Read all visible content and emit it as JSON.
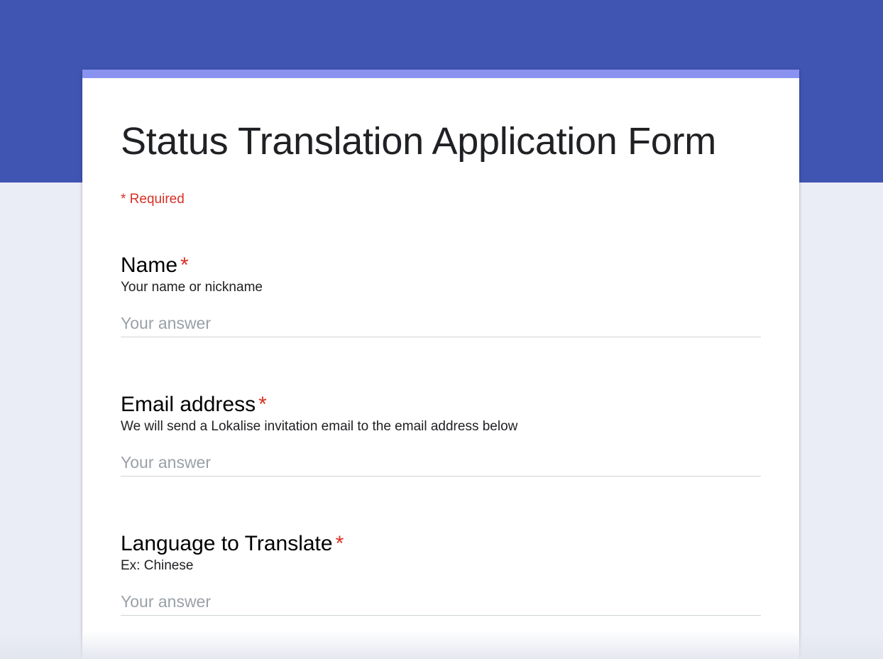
{
  "colors": {
    "header_band": "#3f55b1",
    "accent": "#8a92f0",
    "background": "#eaedf6",
    "required": "#d93025"
  },
  "form": {
    "title": "Status Translation Application Form",
    "required_note": "* Required",
    "questions": [
      {
        "title": "Name",
        "required_mark": "*",
        "description": "Your name or nickname",
        "placeholder": "Your answer"
      },
      {
        "title": "Email address",
        "required_mark": "*",
        "description": "We will send a Lokalise invitation email to the email address below",
        "placeholder": "Your answer"
      },
      {
        "title": "Language to Translate",
        "required_mark": "*",
        "description": "Ex: Chinese",
        "placeholder": "Your answer"
      }
    ]
  }
}
